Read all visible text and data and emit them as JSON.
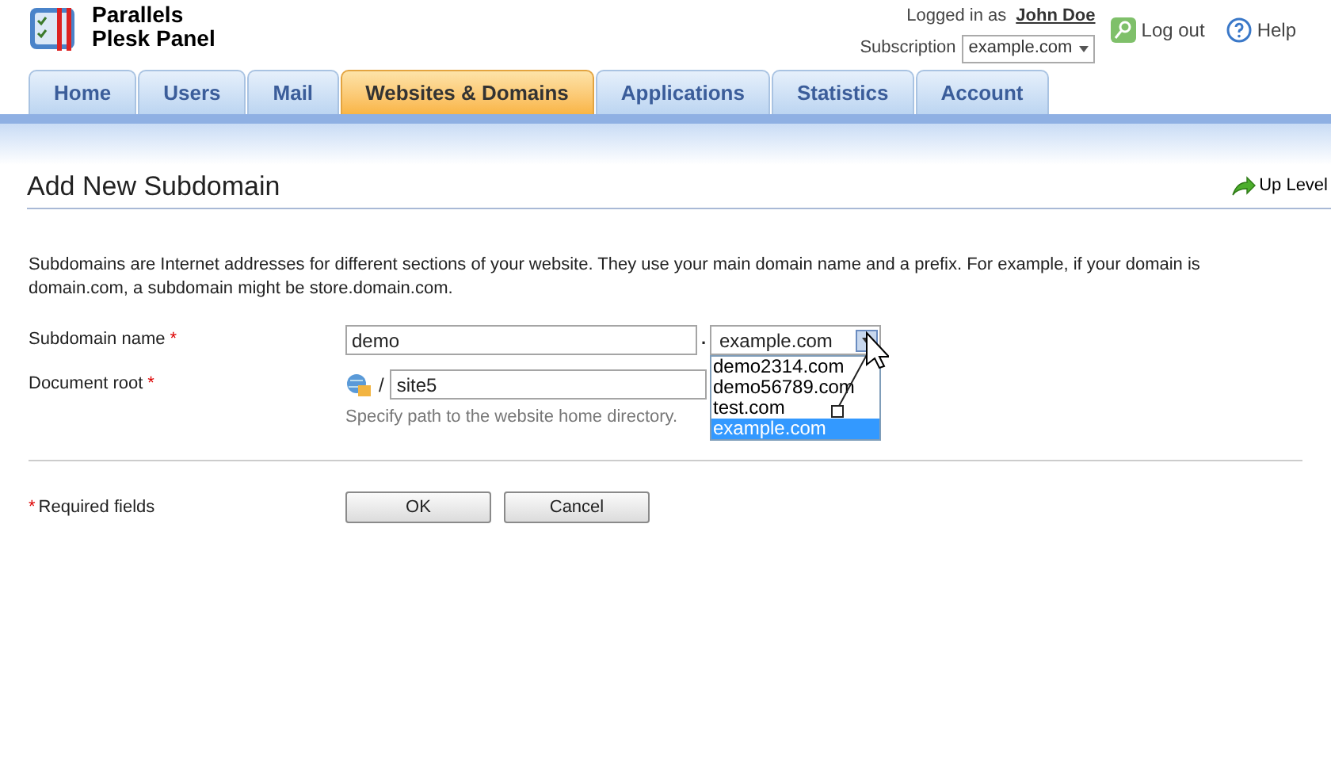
{
  "header": {
    "logo_line1": "Parallels",
    "logo_line2": "Plesk Panel",
    "logged_in_label": "Logged in as",
    "user": "John Doe",
    "subscription_label": "Subscription",
    "subscription": "example.com",
    "logout": "Log out",
    "help": "Help"
  },
  "tabs": [
    {
      "label": "Home",
      "selected": false
    },
    {
      "label": "Users",
      "selected": false
    },
    {
      "label": "Mail",
      "selected": false
    },
    {
      "label": "Websites & Domains",
      "selected": true
    },
    {
      "label": "Applications",
      "selected": false
    },
    {
      "label": "Statistics",
      "selected": false
    },
    {
      "label": "Account",
      "selected": false
    }
  ],
  "page": {
    "title": "Add New Subdomain",
    "up_level": "Up Level",
    "description": "Subdomains are Internet addresses for different sections of your website. They use your main domain name and a prefix. For example, if your domain is domain.com, a subdomain might be store.domain.com."
  },
  "form": {
    "subdomain_label": "Subdomain name",
    "subdomain_value": "demo",
    "separator": ".",
    "domain_value": "example.com",
    "domain_options": [
      {
        "label": "demo2314.com",
        "selected": false
      },
      {
        "label": "demo56789.com",
        "selected": false
      },
      {
        "label": "test.com",
        "selected": false
      },
      {
        "label": "example.com",
        "selected": true
      }
    ],
    "docroot_label": "Document root",
    "docroot_slash": "/",
    "docroot_value": "site5",
    "docroot_hint": "Specify path to the website home directory.",
    "required_mark": "*",
    "required_note": "Required fields"
  },
  "buttons": [
    "OK",
    "Cancel"
  ]
}
